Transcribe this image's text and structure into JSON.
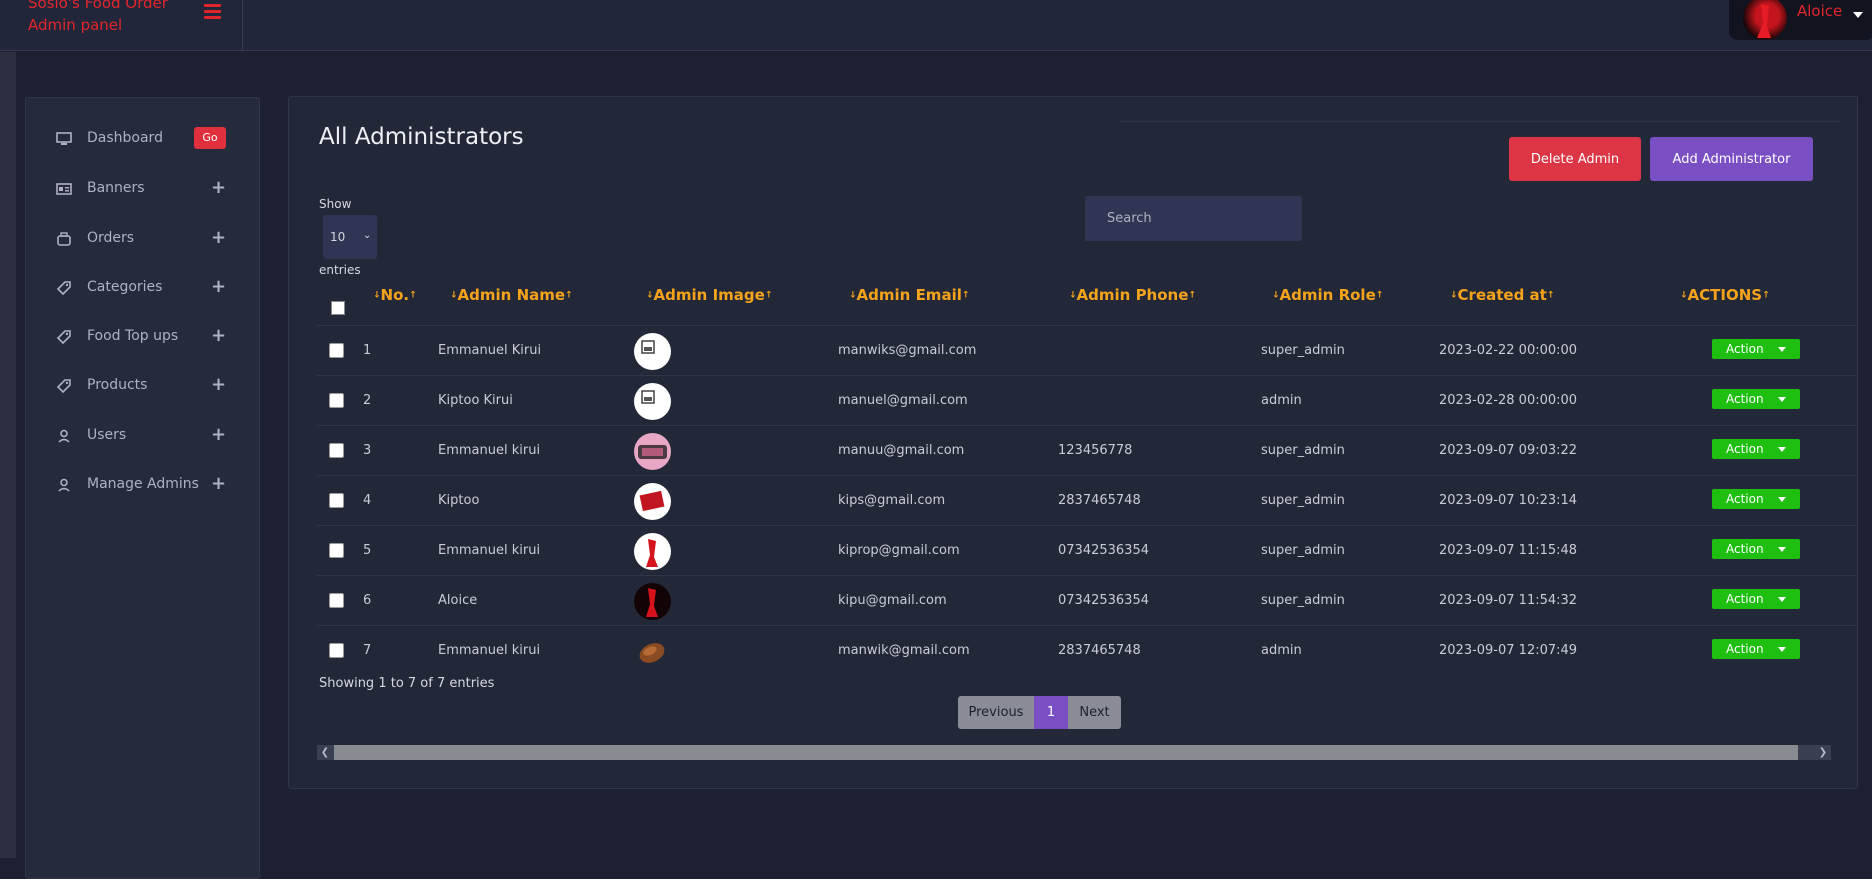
{
  "brand": {
    "title_line1": "Sosio's Food Order",
    "title_line2": "Admin panel"
  },
  "user": {
    "name": "Aloice"
  },
  "sidebar": {
    "items": [
      {
        "label": "Dashboard",
        "icon": "monitor-icon",
        "badge": "Go"
      },
      {
        "label": "Banners",
        "icon": "banner-icon"
      },
      {
        "label": "Orders",
        "icon": "box-icon"
      },
      {
        "label": "Categories",
        "icon": "tag-icon"
      },
      {
        "label": "Food Top ups",
        "icon": "tag-icon"
      },
      {
        "label": "Products",
        "icon": "tag-icon"
      },
      {
        "label": "Users",
        "icon": "user-icon"
      },
      {
        "label": "Manage Admins",
        "icon": "user-icon"
      }
    ]
  },
  "main": {
    "title": "All Administrators",
    "delete_label": "Delete Admin",
    "add_label": "Add Administrator",
    "show_label": "Show",
    "entries_value": "10",
    "entries_label": "entries",
    "search_placeholder": "Search",
    "columns": [
      "No.",
      "Admin Name",
      "Admin Image",
      "Admin Email",
      "Admin Phone",
      "Admin Role",
      "Created at",
      "ACTIONS"
    ],
    "rows": [
      {
        "no": "1",
        "name": "Emmanuel Kirui",
        "image": "broken-image",
        "email": "manwiks@gmail.com",
        "phone": "",
        "role": "super_admin",
        "created": "2023-02-22 00:00:00",
        "action": "Action"
      },
      {
        "no": "2",
        "name": "Kiptoo Kirui",
        "image": "broken-image",
        "email": "manuel@gmail.com",
        "phone": "",
        "role": "admin",
        "created": "2023-02-28 00:00:00",
        "action": "Action"
      },
      {
        "no": "3",
        "name": "Emmanuel kirui",
        "image": "food-photo",
        "email": "manuu@gmail.com",
        "phone": "123456778",
        "role": "super_admin",
        "created": "2023-09-07 09:03:22",
        "action": "Action"
      },
      {
        "no": "4",
        "name": "Kiptoo",
        "image": "red-box-photo",
        "email": "kips@gmail.com",
        "phone": "2837465748",
        "role": "super_admin",
        "created": "2023-09-07 10:23:14",
        "action": "Action"
      },
      {
        "no": "5",
        "name": "Emmanuel kirui",
        "image": "red-hands-photo",
        "email": "kiprop@gmail.com",
        "phone": "07342536354",
        "role": "super_admin",
        "created": "2023-09-07 11:15:48",
        "action": "Action"
      },
      {
        "no": "6",
        "name": "Aloice",
        "image": "red-hands-dark-photo",
        "email": "kipu@gmail.com",
        "phone": "07342536354",
        "role": "super_admin",
        "created": "2023-09-07 11:54:32",
        "action": "Action"
      },
      {
        "no": "7",
        "name": "Emmanuel kirui",
        "image": "brown-item-photo",
        "email": "manwik@gmail.com",
        "phone": "2837465748",
        "role": "admin",
        "created": "2023-09-07 12:07:49",
        "action": "Action"
      }
    ],
    "showing_text": "Showing 1 to 7 of 7 entries",
    "pagination": {
      "prev": "Previous",
      "page": "1",
      "next": "Next"
    }
  },
  "colors": {
    "accent_red": "#e0262b",
    "header_orange": "#f5a31a",
    "action_green": "#1fbf12",
    "purple": "#7b4fc4",
    "danger": "#dc3545"
  }
}
